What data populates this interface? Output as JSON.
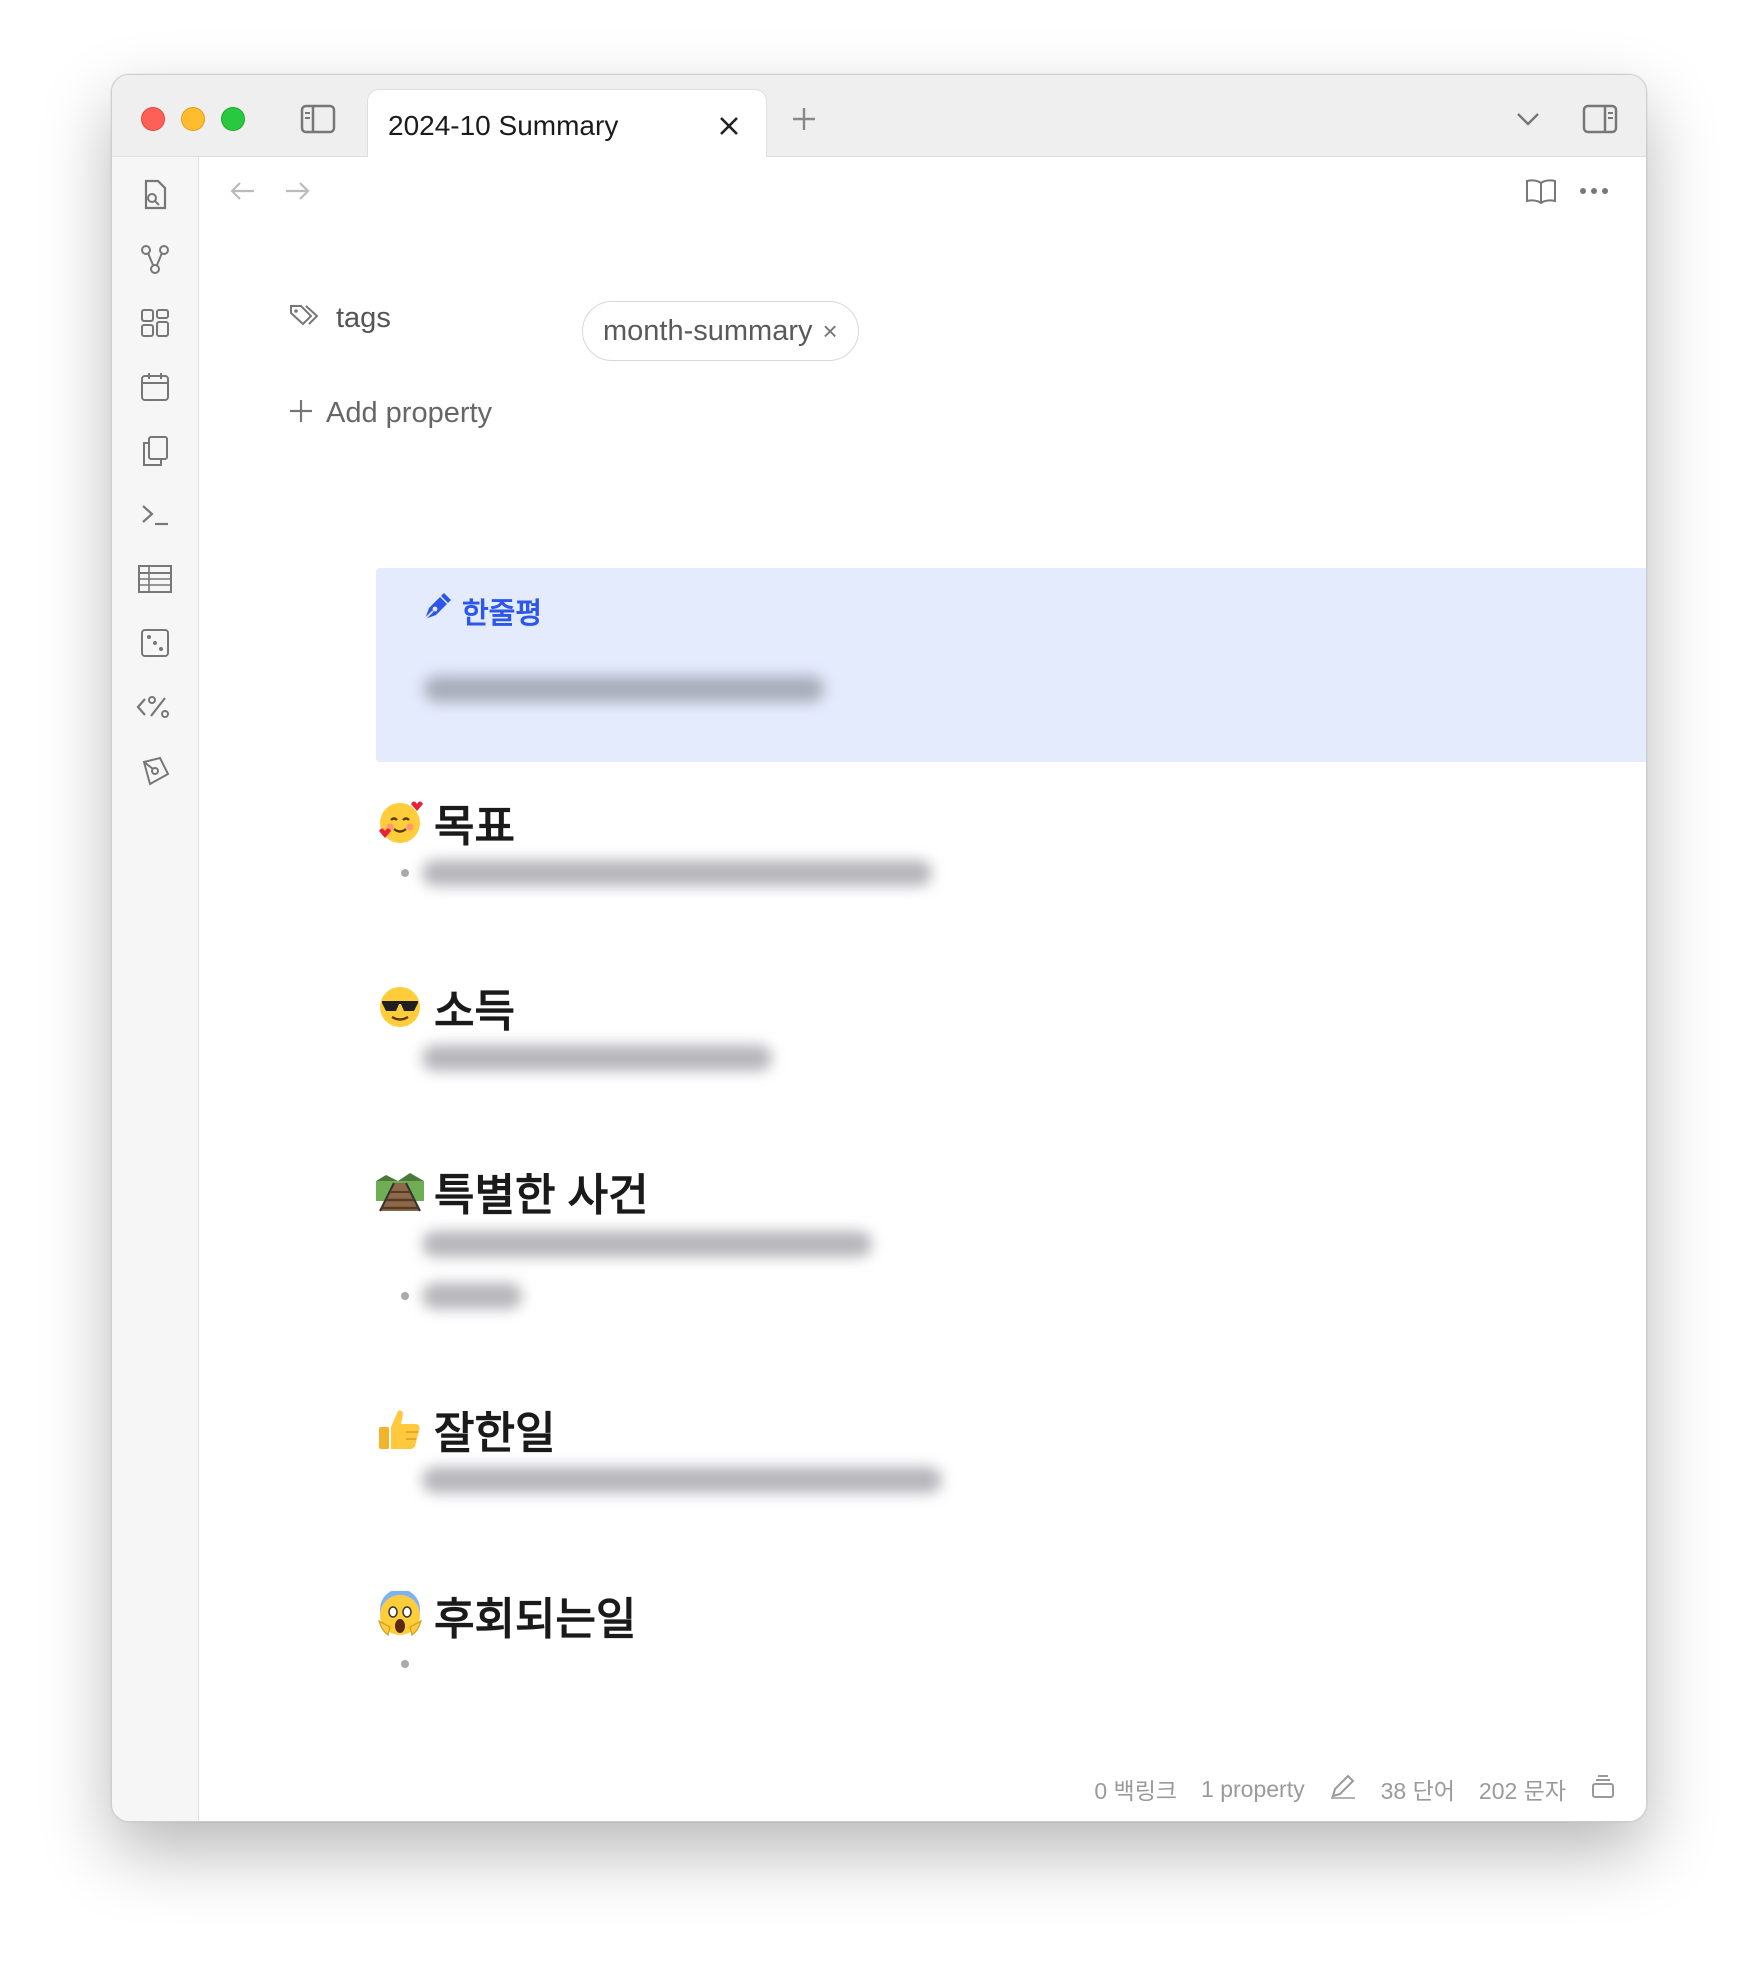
{
  "tab": {
    "title": "2024-10 Summary"
  },
  "properties": {
    "tags_label": "tags",
    "tags": [
      "month-summary"
    ],
    "tag_remove_glyph": "×",
    "add_property_label": "Add property"
  },
  "callout": {
    "title": "한줄평"
  },
  "sections": [
    {
      "title": "목표",
      "emoji": "smiling-face-with-hearts"
    },
    {
      "title": "소득",
      "emoji": "sunglasses-face"
    },
    {
      "title": "특별한 사건",
      "emoji": "railway-track"
    },
    {
      "title": "잘한일",
      "emoji": "thumbs-up"
    },
    {
      "title": "후회되는일",
      "emoji": "screaming-face"
    }
  ],
  "status": {
    "backlinks": "0 백링크",
    "properties": "1 property",
    "words": "38 단어",
    "chars": "202 문자"
  },
  "ribbon_icons": [
    "quick-switcher-icon",
    "graph-view-icon",
    "canvas-icon",
    "daily-notes-icon",
    "templates-icon",
    "command-palette-icon",
    "table-icon",
    "random-note-icon",
    "templater-icon",
    "excalidraw-icon"
  ],
  "colors": {
    "callout_bg": "#e4ebfd",
    "callout_accent": "#2c57e8"
  }
}
